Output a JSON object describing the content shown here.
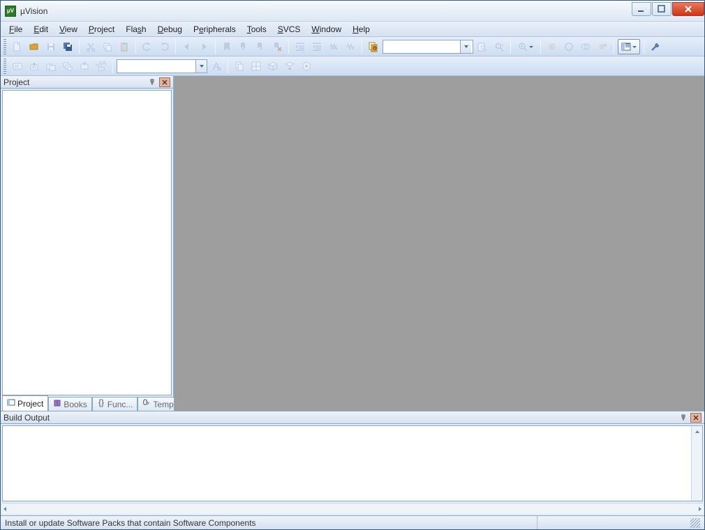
{
  "window": {
    "title": "µVision",
    "appicon_label": "µV"
  },
  "menubar": {
    "items": [
      {
        "label": "File",
        "u": 0
      },
      {
        "label": "Edit",
        "u": 0
      },
      {
        "label": "View",
        "u": 0
      },
      {
        "label": "Project",
        "u": 0
      },
      {
        "label": "Flash",
        "u": 3
      },
      {
        "label": "Debug",
        "u": 0
      },
      {
        "label": "Peripherals",
        "u": 1
      },
      {
        "label": "Tools",
        "u": 0
      },
      {
        "label": "SVCS",
        "u": 0
      },
      {
        "label": "Window",
        "u": 0
      },
      {
        "label": "Help",
        "u": 0
      }
    ]
  },
  "toolbar1": {
    "buttons": [
      {
        "name": "new-file",
        "icon": "new",
        "dim": true
      },
      {
        "name": "open-file",
        "icon": "open",
        "dim": false
      },
      {
        "name": "save",
        "icon": "save",
        "dim": true
      },
      {
        "name": "save-all",
        "icon": "saveall",
        "dim": false
      },
      {
        "sep": true
      },
      {
        "name": "cut",
        "icon": "cut",
        "dim": true
      },
      {
        "name": "copy",
        "icon": "copy",
        "dim": true
      },
      {
        "name": "paste",
        "icon": "paste",
        "dim": true
      },
      {
        "sep": true
      },
      {
        "name": "undo",
        "icon": "undo",
        "dim": true
      },
      {
        "name": "redo",
        "icon": "redo",
        "dim": true
      },
      {
        "sep": true
      },
      {
        "name": "nav-back",
        "icon": "navback",
        "dim": true
      },
      {
        "name": "nav-fwd",
        "icon": "navfwd",
        "dim": true
      },
      {
        "sep": true
      },
      {
        "name": "bookmark-toggle",
        "icon": "bmtoggle",
        "dim": true
      },
      {
        "name": "bookmark-prev",
        "icon": "bmprev",
        "dim": true
      },
      {
        "name": "bookmark-next",
        "icon": "bmnext",
        "dim": true
      },
      {
        "name": "bookmark-clear",
        "icon": "bmclear",
        "dim": true
      },
      {
        "sep": true
      },
      {
        "name": "indent",
        "icon": "indent",
        "dim": true
      },
      {
        "name": "outdent",
        "icon": "outdent",
        "dim": true
      },
      {
        "name": "comment",
        "icon": "comment",
        "dim": true
      },
      {
        "name": "uncomment",
        "icon": "uncomment",
        "dim": true
      },
      {
        "sep": true
      },
      {
        "name": "find-in-files",
        "icon": "findfiles",
        "dim": false
      },
      {
        "search": true
      },
      {
        "name": "find",
        "icon": "find",
        "dim": true
      },
      {
        "name": "incremental-find",
        "icon": "incfind",
        "dim": true
      },
      {
        "sep": true
      },
      {
        "name": "debug-start",
        "icon": "debug",
        "dim": true,
        "drop": true
      },
      {
        "sep": true
      },
      {
        "name": "breakpoint-insert",
        "icon": "bp",
        "dim": true
      },
      {
        "name": "breakpoint-enable",
        "icon": "bpen",
        "dim": true
      },
      {
        "name": "breakpoint-disable",
        "icon": "bpdis",
        "dim": true
      },
      {
        "name": "breakpoint-kill",
        "icon": "bpkill",
        "dim": true
      },
      {
        "sep": true
      },
      {
        "name": "window-layout",
        "icon": "layout",
        "dim": false,
        "active": true,
        "drop": true
      },
      {
        "sep": true
      },
      {
        "name": "configure",
        "icon": "wrench",
        "dim": false
      }
    ],
    "search_value": ""
  },
  "toolbar2": {
    "buttons": [
      {
        "name": "translate",
        "icon": "translate",
        "dim": true
      },
      {
        "name": "build",
        "icon": "build",
        "dim": true
      },
      {
        "name": "rebuild",
        "icon": "rebuild",
        "dim": true
      },
      {
        "name": "batch-build",
        "icon": "batch",
        "dim": true
      },
      {
        "name": "stop-build",
        "icon": "stop",
        "dim": true
      },
      {
        "name": "download",
        "icon": "download",
        "dim": true,
        "label": "LOAD"
      },
      {
        "sep": true
      },
      {
        "targetbox": true
      },
      {
        "name": "target-options",
        "icon": "options",
        "dim": true
      },
      {
        "sep": true
      },
      {
        "name": "file-extensions",
        "icon": "fileext",
        "dim": true
      },
      {
        "name": "manage-multi",
        "icon": "multi",
        "dim": true
      },
      {
        "name": "select-packs",
        "icon": "packs",
        "dim": true
      },
      {
        "name": "pack-installer",
        "icon": "packinst",
        "dim": true
      },
      {
        "name": "manage-rte",
        "icon": "rte",
        "dim": true
      }
    ],
    "target_value": ""
  },
  "project_panel": {
    "title": "Project",
    "tabs": [
      {
        "label": "Project",
        "icon": "proj",
        "active": true
      },
      {
        "label": "Books",
        "icon": "books",
        "active": false
      },
      {
        "label": "Func...",
        "icon": "func",
        "active": false
      },
      {
        "label": "Temp...",
        "icon": "temp",
        "active": false
      }
    ]
  },
  "build_panel": {
    "title": "Build Output"
  },
  "statusbar": {
    "text": "Install or update Software Packs that contain Software Components"
  }
}
